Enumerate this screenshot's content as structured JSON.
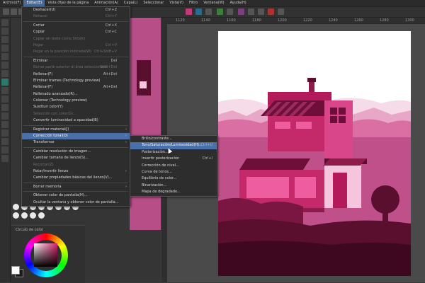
{
  "menubar": {
    "items": [
      {
        "label": "Archivo(F)"
      },
      {
        "label": "Editar(E)"
      },
      {
        "label": "Vista (fija) de la página"
      },
      {
        "label": "Animación(A)"
      },
      {
        "label": "Capa(L)"
      },
      {
        "label": "Seleccionar"
      },
      {
        "label": "Vista(V)"
      },
      {
        "label": "Filtro"
      },
      {
        "label": "Ventana(W)"
      },
      {
        "label": "Ayuda(H)"
      }
    ]
  },
  "ruler": {
    "ticks": [
      "1120",
      "1140",
      "1160",
      "1180",
      "1200",
      "1220",
      "1240",
      "1260",
      "1280",
      "1300"
    ]
  },
  "edit_menu": {
    "items": [
      {
        "label": "Deshacer(U)",
        "shortcut": "Ctrl+Z",
        "disabled": false
      },
      {
        "label": "Rehacer",
        "shortcut": "Ctrl+Y",
        "disabled": true
      },
      {
        "sep": true
      },
      {
        "label": "Cortar",
        "shortcut": "Ctrl+X",
        "disabled": false
      },
      {
        "label": "Copiar",
        "shortcut": "Ctrl+C",
        "disabled": false
      },
      {
        "label": "Copiar en texto como SVG(K)",
        "shortcut": "",
        "disabled": true
      },
      {
        "label": "Pegar",
        "shortcut": "Ctrl+V",
        "disabled": true
      },
      {
        "label": "Pegar en la posición indicada(W)",
        "shortcut": "Ctrl+Shift+V",
        "disabled": true
      },
      {
        "sep": true
      },
      {
        "label": "Eliminar",
        "shortcut": "Del",
        "disabled": false
      },
      {
        "label": "Borrar parte exterior al área seleccionada",
        "shortcut": "Shift+Del",
        "disabled": true
      },
      {
        "label": "Rellenar(F)",
        "shortcut": "Alt+Del",
        "disabled": false
      },
      {
        "label": "Eliminar trames (Technology preview)",
        "shortcut": "",
        "disabled": false
      },
      {
        "label": "Rellenar(F)",
        "shortcut": "Alt+Del",
        "disabled": false
      },
      {
        "label": "Rellenado avanzado(R)...",
        "shortcut": "",
        "disabled": false
      },
      {
        "label": "Colorear (Technology preview)",
        "shortcut": "",
        "disabled": false
      },
      {
        "label": "Sustituir color(Y)",
        "shortcut": "",
        "disabled": false
      },
      {
        "label": "Selección con color(G)...",
        "shortcut": "",
        "disabled": true
      },
      {
        "label": "Convertir luminosidad a opacidad(B)",
        "shortcut": "",
        "disabled": false
      },
      {
        "sep": true
      },
      {
        "label": "Registrar material(J)",
        "shortcut": "",
        "disabled": false,
        "arrow": true
      },
      {
        "label": "Corrección tonal(O)",
        "shortcut": "",
        "disabled": false,
        "arrow": true,
        "hl": true
      },
      {
        "label": "Transformar",
        "shortcut": "",
        "disabled": false,
        "arrow": true
      },
      {
        "sep": true
      },
      {
        "label": "Cambiar resolución de imagen...",
        "shortcut": "",
        "disabled": false
      },
      {
        "label": "Cambiar tamaño de lienzo(S)...",
        "shortcut": "",
        "disabled": false
      },
      {
        "label": "Recortar(Z)",
        "shortcut": "",
        "disabled": true
      },
      {
        "label": "Rotar/invertir lienzo",
        "shortcut": "",
        "disabled": false,
        "arrow": true
      },
      {
        "label": "Cambiar propiedades básicas del lienzo(V)...",
        "shortcut": "",
        "disabled": false
      },
      {
        "sep": true
      },
      {
        "label": "Borrar memoria",
        "shortcut": "",
        "disabled": false,
        "arrow": true
      },
      {
        "sep": true
      },
      {
        "label": "Obtener color de pantalla(H)...",
        "shortcut": "",
        "disabled": false
      },
      {
        "label": "Ocultar la ventana y obtener color de pantalla...",
        "shortcut": "",
        "disabled": false
      }
    ]
  },
  "tonal_submenu": {
    "items": [
      {
        "label": "Brillo/contraste...",
        "shortcut": "",
        "hl": false
      },
      {
        "label": "Tono/Saturación/Luminosidad(H)...",
        "shortcut": "Ctrl+U",
        "hl": true
      },
      {
        "label": "Posterización...",
        "shortcut": "",
        "hl": false
      },
      {
        "label": "Invertir posterización",
        "shortcut": "Ctrl+I",
        "hl": false
      },
      {
        "label": "Corrección de nivel...",
        "shortcut": "",
        "hl": false
      },
      {
        "label": "Curva de tonos...",
        "shortcut": "",
        "hl": false
      },
      {
        "label": "Equilibrio de color...",
        "shortcut": "",
        "hl": false
      },
      {
        "label": "Binarización...",
        "shortcut": "",
        "hl": false
      },
      {
        "label": "Mapa de degradado...",
        "shortcut": "",
        "hl": false
      }
    ]
  },
  "navigator": {
    "label": "Círculo de color"
  },
  "colors": {
    "accent": "#4b6fa8",
    "art_pink": "#d6226a",
    "art_dark": "#5a0f2e",
    "art_mid": "#b84e87",
    "art_light": "#f4c5dc"
  }
}
